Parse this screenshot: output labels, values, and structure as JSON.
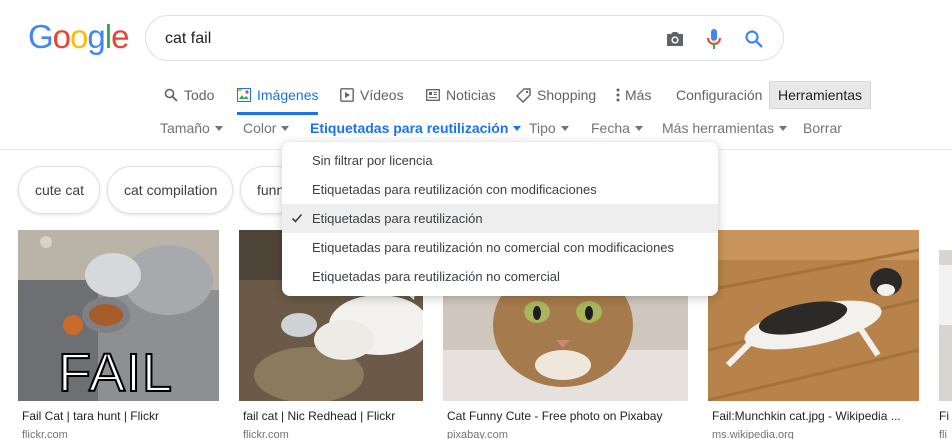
{
  "logo": {
    "letters": [
      "G",
      "o",
      "o",
      "g",
      "l",
      "e"
    ],
    "colors": [
      "#4285F4",
      "#EA4335",
      "#FBBC05",
      "#4285F4",
      "#34A853",
      "#EA4335"
    ]
  },
  "search": {
    "value": "cat fail"
  },
  "icons": {
    "camera": "camera-icon",
    "mic": "microphone-icon",
    "search": "search-icon"
  },
  "tabs": [
    {
      "label": "Todo",
      "icon": "search-icon"
    },
    {
      "label": "Imágenes",
      "icon": "image-icon",
      "active": true
    },
    {
      "label": "Vídeos",
      "icon": "play-icon"
    },
    {
      "label": "Noticias",
      "icon": "news-icon"
    },
    {
      "label": "Shopping",
      "icon": "tag-icon"
    },
    {
      "label": "Más",
      "icon": "more-vert-icon"
    }
  ],
  "settings_label": "Configuración",
  "tools_label": "Herramientas",
  "filters": [
    {
      "label": "Tamaño"
    },
    {
      "label": "Color"
    },
    {
      "label": "Etiquetadas para reutilización",
      "selected": true
    },
    {
      "label": "Tipo"
    },
    {
      "label": "Fecha"
    },
    {
      "label": "Más herramientas"
    }
  ],
  "clear_label": "Borrar",
  "chips": [
    "cute cat",
    "cat compilation",
    "funny"
  ],
  "dropdown": {
    "items": [
      {
        "label": "Sin filtrar por licencia",
        "checked": false
      },
      {
        "label": "Etiquetadas para reutilización con modificaciones",
        "checked": false
      },
      {
        "label": "Etiquetadas para reutilización",
        "checked": true
      },
      {
        "label": "Etiquetadas para reutilización no comercial con modificaciones",
        "checked": false
      },
      {
        "label": "Etiquetadas para reutilización no comercial",
        "checked": false
      }
    ]
  },
  "results": [
    {
      "caption": "Fail Cat | tara hunt | Flickr",
      "domain": "flickr.com",
      "overlay": "FAIL"
    },
    {
      "caption": "fail cat | Nic Redhead | Flickr",
      "domain": "flickr.com"
    },
    {
      "caption": "Cat Funny Cute - Free photo on Pixabay",
      "domain": "pixabay.com"
    },
    {
      "caption": "Fail:Munchkin cat.jpg - Wikipedia ...",
      "domain": "ms.wikipedia.org"
    },
    {
      "caption": "Fi",
      "domain": "fli"
    }
  ],
  "colors": {
    "accent": "#1a73e8",
    "text_secondary": "#5f6368"
  }
}
